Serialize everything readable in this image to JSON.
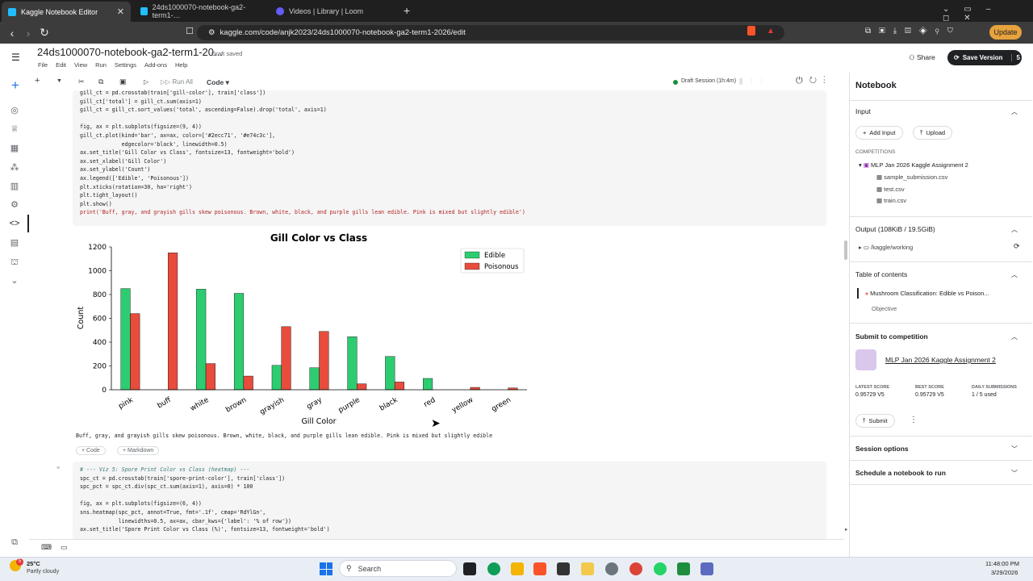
{
  "browser": {
    "tabs": [
      {
        "label": "Kaggle Notebook Editor",
        "active": true
      },
      {
        "label": "24ds1000070-notebook-ga2-term1-…",
        "active": false
      },
      {
        "label": "Videos | Library | Loom",
        "active": false
      }
    ],
    "new_tab": "+",
    "url": "kaggle.com/code/anjk2023/24ds1000070-notebook-ga2-term1-2026/edit",
    "update_label": "Update"
  },
  "header": {
    "title": "24ds1000070-notebook-ga2-term1-20...",
    "status": "Draft saved",
    "menu": [
      "File",
      "Edit",
      "View",
      "Run",
      "Settings",
      "Add-ons",
      "Help"
    ],
    "share_label": "Share",
    "save_version_label": "Save Version",
    "save_version_count": "5"
  },
  "toolbar": {
    "run_all": "Run All",
    "cell_type": "Code",
    "session": "Draft Session (1h:4m)"
  },
  "cell1": {
    "lines": [
      "gill_ct = pd.crosstab(train['gill-color'], train['class'])",
      "gill_ct['total'] = gill_ct.sum(axis=1)",
      "gill_ct = gill_ct.sort_values('total', ascending=False).drop('total', axis=1)",
      "",
      "fig, ax = plt.subplots(figsize=(9, 4))",
      "gill_ct.plot(kind='bar', ax=ax, color=['#2ecc71', '#e74c3c'],",
      "             edgecolor='black', linewidth=0.5)",
      "ax.set_title('Gill Color vs Class', fontsize=13, fontweight='bold')",
      "ax.set_xlabel('Gill Color')",
      "ax.set_ylabel('Count')",
      "ax.legend(['Edible', 'Poisonous'])",
      "plt.xticks(rotation=30, ha='right')",
      "plt.tight_layout()",
      "plt.show()",
      "print('Buff, gray, and grayish gills skew poisonous. Brown, white, black, and purple gills lean edible. Pink is mixed but slightly edible')"
    ],
    "output": "Buff, gray, and grayish gills skew poisonous. Brown, white, black, and purple gills lean edible. Pink is mixed but slightly edible"
  },
  "add_cell": {
    "code": "+ Code",
    "markdown": "+ Markdown"
  },
  "cell2": {
    "lines": [
      "# --- Viz 5: Spore Print Color vs Class (heatmap) ---",
      "spc_ct = pd.crosstab(train['spore-print-color'], train['class'])",
      "spc_pct = spc_ct.div(spc_ct.sum(axis=1), axis=0) * 100",
      "",
      "fig, ax = plt.subplots(figsize=(6, 4))",
      "sns.heatmap(spc_pct, annot=True, fmt='.1f', cmap='RdYlGn',",
      "            linewidths=0.5, ax=ax, cbar_kws={'label': '% of row'})",
      "ax.set_title('Spore Print Color vs Class (%)', fontsize=13, fontweight='bold')"
    ]
  },
  "chart_data": {
    "type": "bar",
    "title": "Gill Color vs Class",
    "xlabel": "Gill Color",
    "ylabel": "Count",
    "categories": [
      "pink",
      "buff",
      "white",
      "brown",
      "grayish",
      "gray",
      "purple",
      "black",
      "red",
      "yellow",
      "green"
    ],
    "series": [
      {
        "name": "Edible",
        "color": "#2ecc71",
        "values": [
          850,
          0,
          845,
          810,
          205,
          185,
          445,
          280,
          95,
          0,
          0
        ]
      },
      {
        "name": "Poisonous",
        "color": "#e74c3c",
        "values": [
          640,
          1150,
          220,
          115,
          530,
          490,
          50,
          65,
          0,
          20,
          15
        ]
      }
    ],
    "ylim": [
      0,
      1200
    ],
    "yticks": [
      0,
      200,
      400,
      600,
      800,
      1000,
      1200
    ],
    "legend": "top-right",
    "grid": false
  },
  "panel": {
    "title": "Notebook",
    "input_label": "Input",
    "add_input": "Add Input",
    "upload": "Upload",
    "competitions_label": "COMPETITIONS",
    "competition": "MLP Jan 2026 Kaggle Assignment 2",
    "files": [
      "sample_submission.csv",
      "test.csv",
      "train.csv"
    ],
    "output_label": "Output (108KiB / 19.5GiB)",
    "output_path": "/kaggle/working",
    "toc_label": "Table of contents",
    "toc_items": [
      "Mushroom Classification: Edible vs Poison...",
      "Objective"
    ],
    "submit_label": "Submit to competition",
    "submit_competition": "MLP Jan 2026 Kaggle Assignment 2",
    "latest_score_label": "LATEST SCORE",
    "latest_score": "0.95729 V5",
    "best_score_label": "BEST SCORE",
    "best_score": "0.95729 V5",
    "daily_label": "DAILY SUBMISSIONS",
    "daily": "1 / 5 used",
    "submit_button": "Submit",
    "session_options": "Session options",
    "schedule": "Schedule a notebook to run"
  },
  "taskbar": {
    "weather_temp": "25°C",
    "weather_desc": "Partly cloudy",
    "search": "Search",
    "time": "11:48:00 PM",
    "date": "3/29/2026"
  }
}
